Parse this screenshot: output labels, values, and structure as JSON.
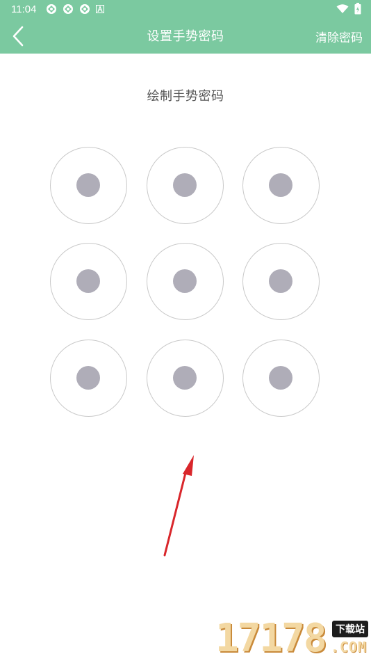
{
  "status_bar": {
    "time": "11:04",
    "left_icons": [
      "notification-icon",
      "notification-icon",
      "notification-icon",
      "a-badge-icon"
    ],
    "right_icons": [
      "wifi-icon",
      "battery-icon"
    ]
  },
  "nav": {
    "back_icon": "chevron-left-icon",
    "title": "设置手势密码",
    "clear_label": "清除密码"
  },
  "prompt": "绘制手势密码",
  "pattern": {
    "rows": 3,
    "cols": 3,
    "nodes": [
      "1",
      "2",
      "3",
      "4",
      "5",
      "6",
      "7",
      "8",
      "9"
    ]
  },
  "colors": {
    "header": "#7bc9a0",
    "dot": "#afadb8",
    "ring": "#c9c9c9",
    "arrow": "#d9262b"
  },
  "watermark": {
    "digits": "17178",
    "badge": "下载站",
    "domain": ".COM"
  }
}
